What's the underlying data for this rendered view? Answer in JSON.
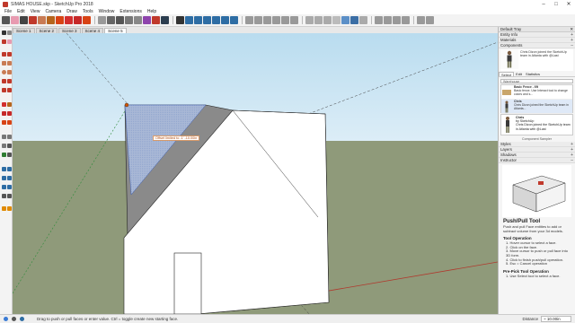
{
  "window": {
    "title": "SIMAS HOUSE.skp - SketchUp Pro 2018",
    "minimize": "–",
    "maximize": "□",
    "close": "✕"
  },
  "menu": [
    "File",
    "Edit",
    "View",
    "Camera",
    "Draw",
    "Tools",
    "Window",
    "Extensions",
    "Help"
  ],
  "scenes": [
    "Scene 1",
    "Scene 2",
    "Scene 3",
    "Scene 4",
    "Scene 5"
  ],
  "active_scene_index": 4,
  "viewport": {
    "vcb_tooltip": "Offset limited to -1' -10.00in",
    "colors": {
      "sky": "#c9e4f3",
      "ground": "#8f9a7a",
      "wall": "#ffffff",
      "roof": "#8a8a8a",
      "selected_face": "#a9b8d6"
    }
  },
  "status": {
    "hint": "Drag to push or pull faces or enter value. Ctrl = toggle create new starting face.",
    "measure_label": "Distance",
    "measure_value": "~ 10.00in"
  },
  "tray": {
    "title": "Default Tray",
    "pin": "✕",
    "sections": {
      "entity_info": "Entity Info",
      "materials": "Materials",
      "components": "Components",
      "styles": "Styles",
      "layers": "Layers",
      "shadows": "Shadows",
      "instructor": "Instructor"
    },
    "component_preview": {
      "text": "Chris Dizon joined the SketchUp team in Atlanta with @Last"
    },
    "tabs": [
      "Select",
      "Edit",
      "Statistics"
    ],
    "search_placeholder": "Warehouse",
    "list": [
      {
        "name": "Basic Fence - 6ft",
        "desc": "Basic fence. Use Interact tool to change colors and s..."
      },
      {
        "name": "Chris",
        "desc": "Chris Dizon joined the SketchUp team in Atlanta..."
      }
    ],
    "detail": {
      "name": "Chris",
      "by": "by SketchUp",
      "desc": "Chris Dizon joined the SketchUp team in Atlanta with @Last"
    },
    "sampler": "Component Sampler",
    "instructor": {
      "title": "Push/Pull Tool",
      "intro": "Push and pull Face entities to add or subtract volume from your 3d models.",
      "op_heading": "Tool Operation",
      "steps": [
        "1.  Hover cursor to select a face.",
        "2.  Click on the face.",
        "3.  Move cursor to push or pull face into 3D form.",
        "4.  Click to finish push/pull operation.",
        "5.  Esc = Cancel operation"
      ],
      "pre_heading": "Pre-Pick Tool Operation",
      "pre_steps": [
        "1.  Use Select tool to select a face."
      ]
    }
  }
}
